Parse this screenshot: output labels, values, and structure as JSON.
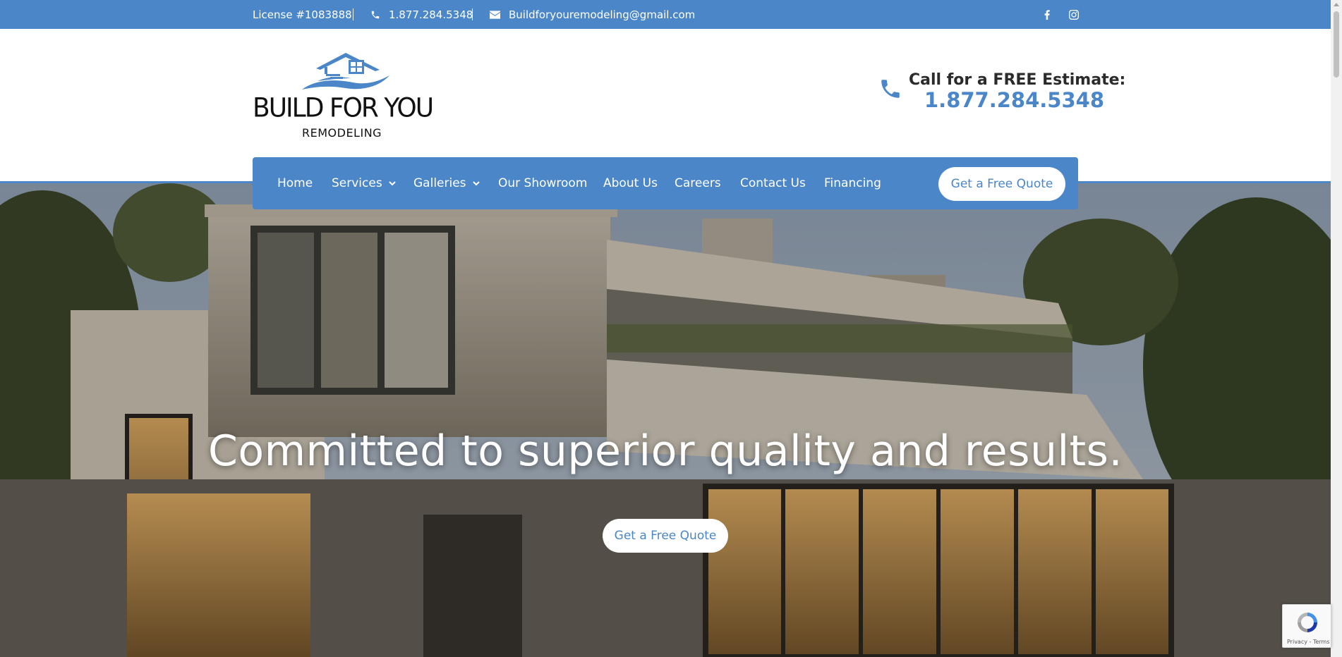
{
  "topbar": {
    "license": "License #1083888",
    "phone": "1.877.284.5348",
    "email": "Buildforyouremodeling@gmail.com",
    "icons": [
      "phone-icon",
      "envelope-icon",
      "facebook-icon",
      "instagram-icon"
    ]
  },
  "logo": {
    "brand": "BUILD FOR YOU",
    "sub": "REMODELING"
  },
  "estimate": {
    "label": "Call for a FREE Estimate:",
    "phone": "1.877.284.5348"
  },
  "nav": {
    "items": [
      {
        "label": "Home"
      },
      {
        "label": "Services"
      },
      {
        "label": "Galleries"
      },
      {
        "label": "Our Showroom"
      },
      {
        "label": "About Us"
      },
      {
        "label": "Careers"
      },
      {
        "label": "Contact Us"
      },
      {
        "label": "Financing"
      }
    ],
    "quote_label": "Get a Free Quote"
  },
  "hero": {
    "title": "Committed to superior quality and results.",
    "button_label": "Get a Free Quote"
  },
  "recaptcha": {
    "text": "Privacy - Terms"
  },
  "colors": {
    "accent": "#4a86c8",
    "white": "#ffffff"
  }
}
